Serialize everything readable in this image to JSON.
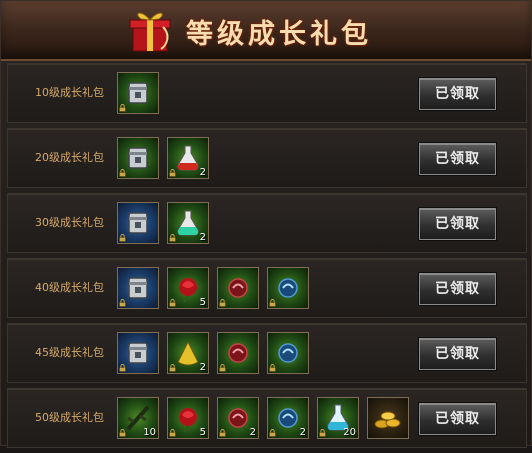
{
  "header": {
    "title": "等级成长礼包"
  },
  "claim_label": "已领取",
  "rows": [
    {
      "label": "10级成长礼包",
      "items": [
        {
          "icon": "silver-box-icon",
          "count": ""
        }
      ]
    },
    {
      "label": "20级成长礼包",
      "items": [
        {
          "icon": "silver-box-icon",
          "count": ""
        },
        {
          "icon": "red-potion-icon",
          "count": "2"
        }
      ]
    },
    {
      "label": "30级成长礼包",
      "items": [
        {
          "icon": "silver-box-icon",
          "count": ""
        },
        {
          "icon": "green-potion-icon",
          "count": "2"
        }
      ]
    },
    {
      "label": "40级成长礼包",
      "items": [
        {
          "icon": "silver-box-icon",
          "count": ""
        },
        {
          "icon": "red-rose-icon",
          "count": "5"
        },
        {
          "icon": "red-charm-icon",
          "count": ""
        },
        {
          "icon": "blue-charm-icon",
          "count": ""
        }
      ]
    },
    {
      "label": "45级成长礼包",
      "items": [
        {
          "icon": "silver-box-icon",
          "count": ""
        },
        {
          "icon": "yellow-cloak-icon",
          "count": "2"
        },
        {
          "icon": "red-charm-icon",
          "count": ""
        },
        {
          "icon": "blue-charm-icon",
          "count": ""
        }
      ]
    },
    {
      "label": "50级成长礼包",
      "items": [
        {
          "icon": "dark-branch-icon",
          "count": "10"
        },
        {
          "icon": "red-rose-icon",
          "count": "5"
        },
        {
          "icon": "red-charm-icon",
          "count": "2"
        },
        {
          "icon": "blue-charm-icon",
          "count": "2"
        },
        {
          "icon": "blue-potion-icon",
          "count": "20"
        },
        {
          "icon": "gold-coins-icon",
          "count": ""
        }
      ]
    }
  ]
}
